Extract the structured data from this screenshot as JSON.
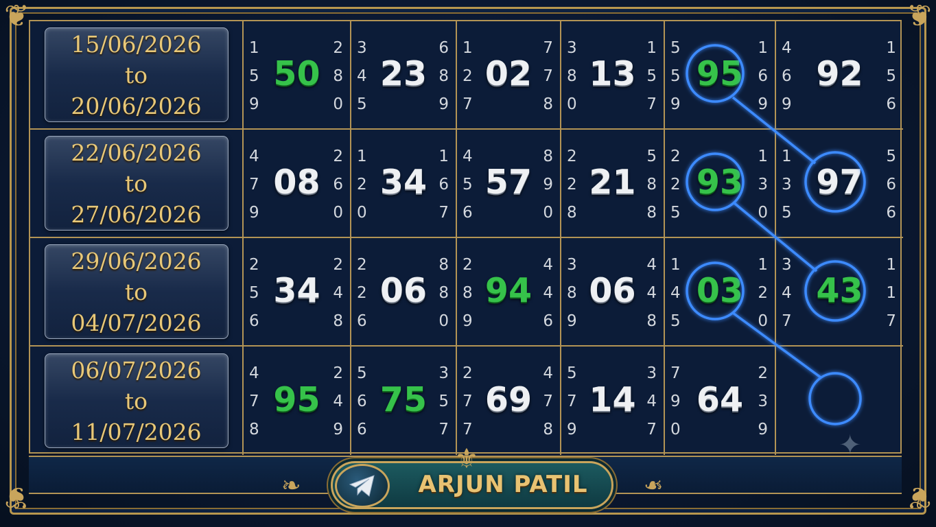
{
  "weeks": [
    {
      "from": "15/06/2026",
      "to_word": "to",
      "to": "20/06/2026",
      "days": [
        {
          "left": [
            "1",
            "5",
            "9"
          ],
          "num": "50",
          "right": [
            "2",
            "8",
            "0"
          ],
          "color": "green"
        },
        {
          "left": [
            "3",
            "4",
            "5"
          ],
          "num": "23",
          "right": [
            "6",
            "8",
            "9"
          ],
          "color": "white"
        },
        {
          "left": [
            "1",
            "2",
            "7"
          ],
          "num": "02",
          "right": [
            "7",
            "7",
            "8"
          ],
          "color": "white"
        },
        {
          "left": [
            "3",
            "8",
            "0"
          ],
          "num": "13",
          "right": [
            "1",
            "5",
            "7"
          ],
          "color": "white"
        },
        {
          "left": [
            "5",
            "5",
            "9"
          ],
          "num": "95",
          "right": [
            "1",
            "6",
            "9"
          ],
          "color": "green"
        },
        {
          "left": [
            "4",
            "6",
            "9"
          ],
          "num": "92",
          "right": [
            "1",
            "5",
            "6"
          ],
          "color": "white"
        }
      ]
    },
    {
      "from": "22/06/2026",
      "to_word": "to",
      "to": "27/06/2026",
      "days": [
        {
          "left": [
            "4",
            "7",
            "9"
          ],
          "num": "08",
          "right": [
            "2",
            "6",
            "0"
          ],
          "color": "white"
        },
        {
          "left": [
            "1",
            "2",
            "0"
          ],
          "num": "34",
          "right": [
            "1",
            "6",
            "7"
          ],
          "color": "white"
        },
        {
          "left": [
            "4",
            "5",
            "6"
          ],
          "num": "57",
          "right": [
            "8",
            "9",
            "0"
          ],
          "color": "white"
        },
        {
          "left": [
            "2",
            "2",
            "8"
          ],
          "num": "21",
          "right": [
            "5",
            "8",
            "8"
          ],
          "color": "white"
        },
        {
          "left": [
            "2",
            "2",
            "5"
          ],
          "num": "93",
          "right": [
            "1",
            "3",
            "0"
          ],
          "color": "green"
        },
        {
          "left": [
            "1",
            "3",
            "5"
          ],
          "num": "97",
          "right": [
            "5",
            "6",
            "6"
          ],
          "color": "white"
        }
      ]
    },
    {
      "from": "29/06/2026",
      "to_word": "to",
      "to": "04/07/2026",
      "days": [
        {
          "left": [
            "2",
            "5",
            "6"
          ],
          "num": "34",
          "right": [
            "2",
            "4",
            "8"
          ],
          "color": "white"
        },
        {
          "left": [
            "2",
            "2",
            "6"
          ],
          "num": "06",
          "right": [
            "8",
            "8",
            "0"
          ],
          "color": "white"
        },
        {
          "left": [
            "2",
            "8",
            "9"
          ],
          "num": "94",
          "right": [
            "4",
            "4",
            "6"
          ],
          "color": "green"
        },
        {
          "left": [
            "3",
            "8",
            "9"
          ],
          "num": "06",
          "right": [
            "4",
            "4",
            "8"
          ],
          "color": "white"
        },
        {
          "left": [
            "1",
            "4",
            "5"
          ],
          "num": "03",
          "right": [
            "1",
            "2",
            "0"
          ],
          "color": "green"
        },
        {
          "left": [
            "3",
            "4",
            "7"
          ],
          "num": "43",
          "right": [
            "1",
            "1",
            "7"
          ],
          "color": "green"
        }
      ]
    },
    {
      "from": "06/07/2026",
      "to_word": "to",
      "to": "11/07/2026",
      "days": [
        {
          "left": [
            "4",
            "7",
            "8"
          ],
          "num": "95",
          "right": [
            "2",
            "4",
            "9"
          ],
          "color": "green"
        },
        {
          "left": [
            "5",
            "6",
            "6"
          ],
          "num": "75",
          "right": [
            "3",
            "5",
            "7"
          ],
          "color": "green"
        },
        {
          "left": [
            "2",
            "7",
            "7"
          ],
          "num": "69",
          "right": [
            "4",
            "7",
            "8"
          ],
          "color": "white"
        },
        {
          "left": [
            "5",
            "7",
            "9"
          ],
          "num": "14",
          "right": [
            "3",
            "4",
            "7"
          ],
          "color": "white"
        },
        {
          "left": [
            "7",
            "9",
            "0"
          ],
          "num": "64",
          "right": [
            "2",
            "3",
            "9"
          ],
          "color": "white"
        },
        {
          "left": [
            "",
            "",
            ""
          ],
          "num": "",
          "right": [
            "",
            "",
            ""
          ],
          "color": "white"
        }
      ]
    }
  ],
  "banner": {
    "name": "ARJUN PATIL",
    "icon": "telegram-icon"
  },
  "colors": {
    "gold": "#b39455",
    "green": "#36c24a",
    "glow": "#2f7dff",
    "background": "#0b1933"
  }
}
